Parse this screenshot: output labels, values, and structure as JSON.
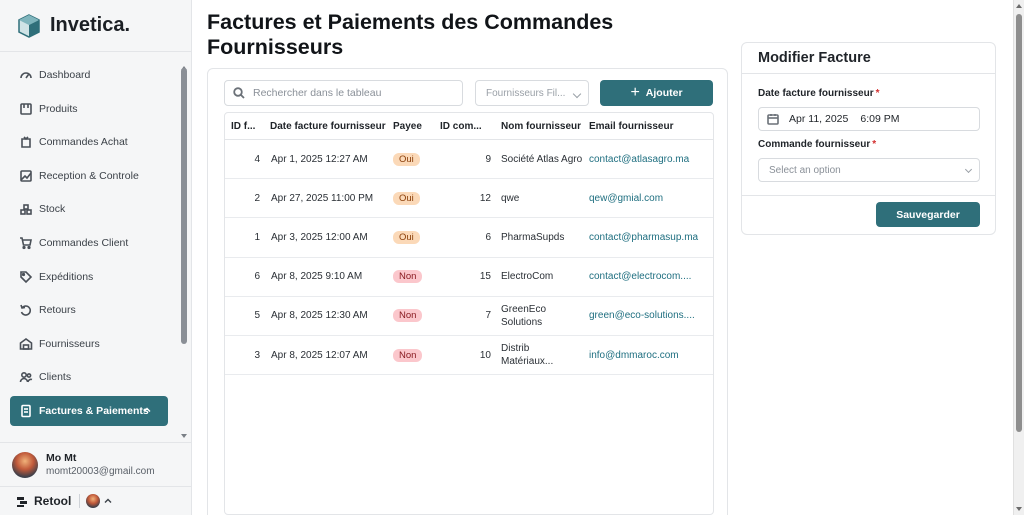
{
  "brand": {
    "name": "Invetica."
  },
  "sidebar": {
    "items": [
      {
        "label": "Dashboard",
        "icon": "dashboard-gauge-icon"
      },
      {
        "label": "Produits",
        "icon": "box-icon"
      },
      {
        "label": "Commandes Achat",
        "icon": "purchase-icon"
      },
      {
        "label": "Reception & Controle",
        "icon": "reception-icon"
      },
      {
        "label": "Stock",
        "icon": "stock-icon"
      },
      {
        "label": "Commandes Client",
        "icon": "cart-icon"
      },
      {
        "label": "Expéditions",
        "icon": "tag-icon"
      },
      {
        "label": "Retours",
        "icon": "return-icon"
      },
      {
        "label": "Fournisseurs",
        "icon": "warehouse-icon"
      },
      {
        "label": "Clients",
        "icon": "users-icon"
      },
      {
        "label": "Factures & Paiements",
        "icon": "invoice-icon",
        "active": true
      }
    ]
  },
  "user": {
    "name": "Mo Mt",
    "email": "momt20003@gmail.com"
  },
  "footer": {
    "retool_label": "Retool"
  },
  "page": {
    "title": "Factures et Paiements des Commandes Fournisseurs"
  },
  "toolbar": {
    "search_placeholder": "Rechercher dans le tableau",
    "filter_placeholder": "Fournisseurs Fil...",
    "add_label": "Ajouter"
  },
  "table": {
    "columns": [
      "ID f...",
      "Date facture fournisseur",
      "Payee",
      "ID com...",
      "Nom fournisseur",
      "Email fournisseur"
    ],
    "rows": [
      {
        "id": "4",
        "date": "Apr 1, 2025 12:27 AM",
        "payee": "Oui",
        "id_cmd": "9",
        "nom": "Société Atlas Agro",
        "email": "contact@atlasagro.ma"
      },
      {
        "id": "2",
        "date": "Apr 27, 2025 11:00 PM",
        "payee": "Oui",
        "id_cmd": "12",
        "nom": "qwe",
        "email": "qew@gmial.com"
      },
      {
        "id": "1",
        "date": "Apr 3, 2025 12:00 AM",
        "payee": "Oui",
        "id_cmd": "6",
        "nom": "PharmaSupds",
        "email": "contact@pharmasup.ma"
      },
      {
        "id": "6",
        "date": "Apr 8, 2025 9:10 AM",
        "payee": "Non",
        "id_cmd": "15",
        "nom": "ElectroCom",
        "email": "contact@electrocom...."
      },
      {
        "id": "5",
        "date": "Apr 8, 2025 12:30 AM",
        "payee": "Non",
        "id_cmd": "7",
        "nom": "GreenEco Solutions",
        "email": "green@eco-solutions...."
      },
      {
        "id": "3",
        "date": "Apr 8, 2025 12:07 AM",
        "payee": "Non",
        "id_cmd": "10",
        "nom": "Distrib Matériaux...",
        "email": "info@dmmaroc.com"
      }
    ]
  },
  "panel": {
    "title": "Modifier Facture",
    "date_label": "Date facture fournisseur",
    "date_value": "Apr 11, 2025",
    "time_value": "6:09 PM",
    "commande_label": "Commande fournisseur",
    "commande_placeholder": "Select an option",
    "required_mark": "*",
    "save_label": "Sauvegarder"
  },
  "colors": {
    "accent": "#2f6f7a",
    "oui_bg": "#fbd9b8",
    "non_bg": "#fbc7cc",
    "link": "#1f6f80"
  }
}
